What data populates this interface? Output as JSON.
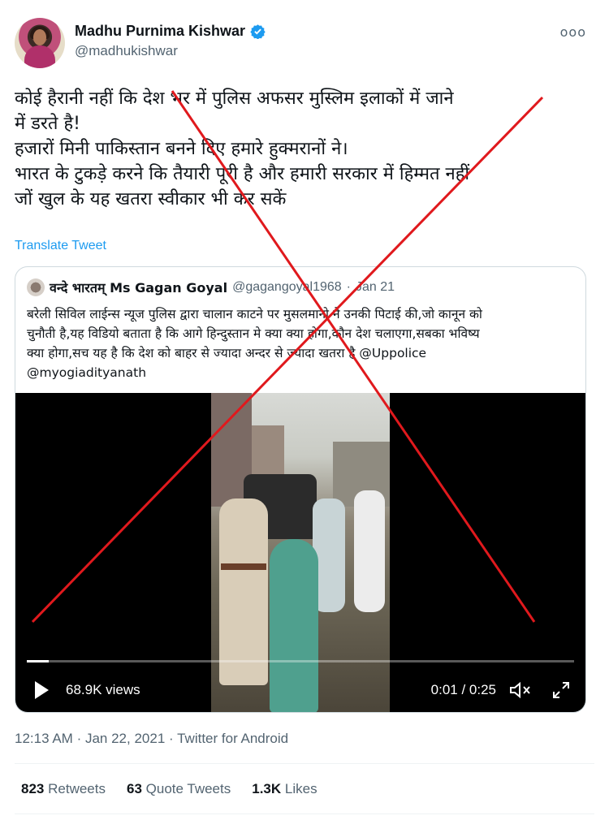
{
  "author": {
    "display_name": "Madhu Purnima Kishwar",
    "handle": "@madhukishwar",
    "verified_badge_icon": "verified-badge-icon",
    "more_label": "ooo"
  },
  "tweet": {
    "lines": [
      "कोई हैरानी नहीं कि देश भर में पुलिस अफसर मुस्लिम इलाकों में जाने",
      "में डरते है!",
      "हजारों मिनी पाकिस्तान बनने दिए हमारे हुक्मरानों ने।",
      "भारत के टुकड़े करने कि तैयारी पूरी है और हमारी सरकार में हिम्मत नहीं",
      "जों खुल के यह खतरा स्वीकार भी कर सकें"
    ],
    "translate_label": "Translate Tweet"
  },
  "quoted": {
    "name": "वन्दे भारतम् Ms Gagan Goyal",
    "handle": "@gagangoyal1968",
    "dot": "·",
    "date": "Jan 21",
    "lines": [
      "बरेली सिविल लाईन्स न्यूज पुलिस द्वारा चालान काटने पर मुसलमानो ने उनकी पिटाई की,जो कानून को",
      "चुनौती है,यह विडियो बताता है कि आगे हिन्दुस्तान मे क्या क्या होगा,कौन देश चलाएगा,सबका भविष्य",
      "क्या होगा,सच यह है कि देश को बाहर से ज्यादा अन्दर से ज्यादा खतरा है @Uppolice",
      "@myogiadityanath"
    ],
    "video": {
      "views": "68.9K views",
      "time": "0:01 / 0:25",
      "progress_fraction": 0.04,
      "play_icon": "play-icon",
      "mute_icon": "mute-icon",
      "fullscreen_icon": "fullscreen-icon"
    }
  },
  "meta": {
    "time": "12:13 AM",
    "sep1": "·",
    "date": "Jan 22, 2021",
    "sep2": "·",
    "source": "Twitter for Android"
  },
  "stats": {
    "retweets_count": "823",
    "retweets_label": "Retweets",
    "quotes_count": "63",
    "quotes_label": "Quote Tweets",
    "likes_count": "1.3K",
    "likes_label": "Likes"
  },
  "colors": {
    "accent": "#1d9bf0",
    "cross": "#e0191d",
    "muted": "#536471"
  }
}
